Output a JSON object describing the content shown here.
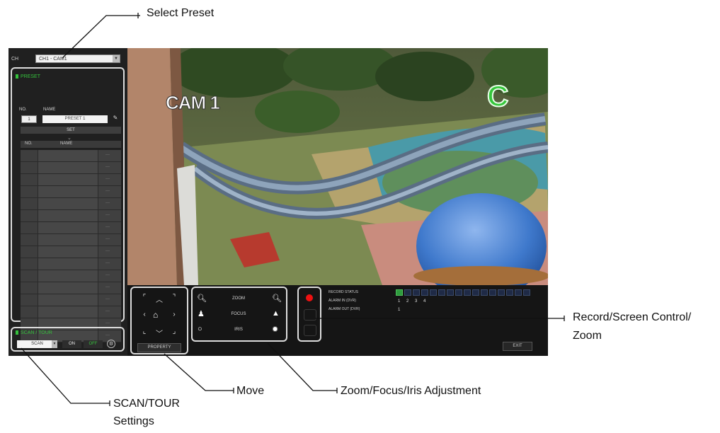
{
  "colors": {
    "accent_green": "#35c13c",
    "record_red": "#e11111",
    "frame_white": "#dcdcdc"
  },
  "channel": {
    "label": "CH",
    "selected": "CH1 - CAM1"
  },
  "preset": {
    "title": "PRESET",
    "col_no": "NO.",
    "col_name": "NAME",
    "no_value": "1",
    "name_value": "PRESET 1",
    "set_label": "SET",
    "list_no": "NO.",
    "list_name": "NAME"
  },
  "scan_tour": {
    "title": "SCAN / TOUR",
    "mode": "SCAN",
    "on_label": "ON",
    "off_label": "OFF"
  },
  "camera": {
    "label": "CAM 1",
    "badge": "C"
  },
  "move": {
    "property_label": "PROPERTY"
  },
  "adjust": {
    "zoom_label": "ZOOM",
    "focus_label": "FOCUS",
    "iris_label": "IRIS"
  },
  "status": {
    "record_label": "RECORD STATUS",
    "alarm_in_label": "ALARM IN (DVR)",
    "alarm_out_label": "ALARM OUT (DVR)",
    "alarm_in_values": [
      "1",
      "2",
      "3",
      "4"
    ],
    "alarm_out_values": [
      "1"
    ]
  },
  "exit_label": "EXIT",
  "annotations": {
    "select_preset": "Select Preset",
    "record_zoom_line1": "Record/Screen Control/",
    "record_zoom_line2": "Zoom",
    "scan_tour_line1": "SCAN/TOUR",
    "scan_tour_line2": "Settings",
    "move": "Move",
    "zoom_focus_iris": "Zoom/Focus/Iris Adjustment"
  }
}
